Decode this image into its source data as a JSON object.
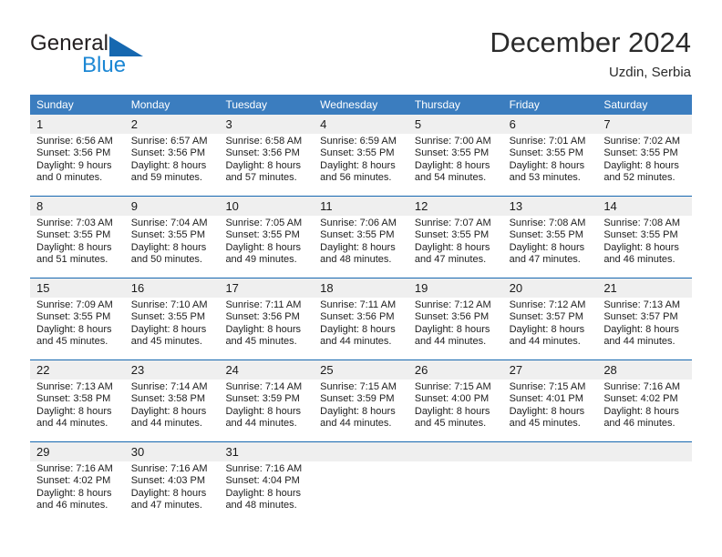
{
  "brand": {
    "name_top": "General",
    "name_bottom": "Blue"
  },
  "header": {
    "title": "December 2024",
    "location": "Uzdin, Serbia"
  },
  "weekdays": [
    "Sunday",
    "Monday",
    "Tuesday",
    "Wednesday",
    "Thursday",
    "Friday",
    "Saturday"
  ],
  "colors": {
    "header_blue": "#3b7dbf",
    "separator_blue": "#1668b0",
    "daynum_band": "#efefef",
    "logo_blue": "#1c87d4"
  },
  "weeks": [
    [
      {
        "day": "1",
        "lines": [
          "Sunrise: 6:56 AM",
          "Sunset: 3:56 PM",
          "Daylight: 9 hours",
          "and 0 minutes."
        ]
      },
      {
        "day": "2",
        "lines": [
          "Sunrise: 6:57 AM",
          "Sunset: 3:56 PM",
          "Daylight: 8 hours",
          "and 59 minutes."
        ]
      },
      {
        "day": "3",
        "lines": [
          "Sunrise: 6:58 AM",
          "Sunset: 3:56 PM",
          "Daylight: 8 hours",
          "and 57 minutes."
        ]
      },
      {
        "day": "4",
        "lines": [
          "Sunrise: 6:59 AM",
          "Sunset: 3:55 PM",
          "Daylight: 8 hours",
          "and 56 minutes."
        ]
      },
      {
        "day": "5",
        "lines": [
          "Sunrise: 7:00 AM",
          "Sunset: 3:55 PM",
          "Daylight: 8 hours",
          "and 54 minutes."
        ]
      },
      {
        "day": "6",
        "lines": [
          "Sunrise: 7:01 AM",
          "Sunset: 3:55 PM",
          "Daylight: 8 hours",
          "and 53 minutes."
        ]
      },
      {
        "day": "7",
        "lines": [
          "Sunrise: 7:02 AM",
          "Sunset: 3:55 PM",
          "Daylight: 8 hours",
          "and 52 minutes."
        ]
      }
    ],
    [
      {
        "day": "8",
        "lines": [
          "Sunrise: 7:03 AM",
          "Sunset: 3:55 PM",
          "Daylight: 8 hours",
          "and 51 minutes."
        ]
      },
      {
        "day": "9",
        "lines": [
          "Sunrise: 7:04 AM",
          "Sunset: 3:55 PM",
          "Daylight: 8 hours",
          "and 50 minutes."
        ]
      },
      {
        "day": "10",
        "lines": [
          "Sunrise: 7:05 AM",
          "Sunset: 3:55 PM",
          "Daylight: 8 hours",
          "and 49 minutes."
        ]
      },
      {
        "day": "11",
        "lines": [
          "Sunrise: 7:06 AM",
          "Sunset: 3:55 PM",
          "Daylight: 8 hours",
          "and 48 minutes."
        ]
      },
      {
        "day": "12",
        "lines": [
          "Sunrise: 7:07 AM",
          "Sunset: 3:55 PM",
          "Daylight: 8 hours",
          "and 47 minutes."
        ]
      },
      {
        "day": "13",
        "lines": [
          "Sunrise: 7:08 AM",
          "Sunset: 3:55 PM",
          "Daylight: 8 hours",
          "and 47 minutes."
        ]
      },
      {
        "day": "14",
        "lines": [
          "Sunrise: 7:08 AM",
          "Sunset: 3:55 PM",
          "Daylight: 8 hours",
          "and 46 minutes."
        ]
      }
    ],
    [
      {
        "day": "15",
        "lines": [
          "Sunrise: 7:09 AM",
          "Sunset: 3:55 PM",
          "Daylight: 8 hours",
          "and 45 minutes."
        ]
      },
      {
        "day": "16",
        "lines": [
          "Sunrise: 7:10 AM",
          "Sunset: 3:55 PM",
          "Daylight: 8 hours",
          "and 45 minutes."
        ]
      },
      {
        "day": "17",
        "lines": [
          "Sunrise: 7:11 AM",
          "Sunset: 3:56 PM",
          "Daylight: 8 hours",
          "and 45 minutes."
        ]
      },
      {
        "day": "18",
        "lines": [
          "Sunrise: 7:11 AM",
          "Sunset: 3:56 PM",
          "Daylight: 8 hours",
          "and 44 minutes."
        ]
      },
      {
        "day": "19",
        "lines": [
          "Sunrise: 7:12 AM",
          "Sunset: 3:56 PM",
          "Daylight: 8 hours",
          "and 44 minutes."
        ]
      },
      {
        "day": "20",
        "lines": [
          "Sunrise: 7:12 AM",
          "Sunset: 3:57 PM",
          "Daylight: 8 hours",
          "and 44 minutes."
        ]
      },
      {
        "day": "21",
        "lines": [
          "Sunrise: 7:13 AM",
          "Sunset: 3:57 PM",
          "Daylight: 8 hours",
          "and 44 minutes."
        ]
      }
    ],
    [
      {
        "day": "22",
        "lines": [
          "Sunrise: 7:13 AM",
          "Sunset: 3:58 PM",
          "Daylight: 8 hours",
          "and 44 minutes."
        ]
      },
      {
        "day": "23",
        "lines": [
          "Sunrise: 7:14 AM",
          "Sunset: 3:58 PM",
          "Daylight: 8 hours",
          "and 44 minutes."
        ]
      },
      {
        "day": "24",
        "lines": [
          "Sunrise: 7:14 AM",
          "Sunset: 3:59 PM",
          "Daylight: 8 hours",
          "and 44 minutes."
        ]
      },
      {
        "day": "25",
        "lines": [
          "Sunrise: 7:15 AM",
          "Sunset: 3:59 PM",
          "Daylight: 8 hours",
          "and 44 minutes."
        ]
      },
      {
        "day": "26",
        "lines": [
          "Sunrise: 7:15 AM",
          "Sunset: 4:00 PM",
          "Daylight: 8 hours",
          "and 45 minutes."
        ]
      },
      {
        "day": "27",
        "lines": [
          "Sunrise: 7:15 AM",
          "Sunset: 4:01 PM",
          "Daylight: 8 hours",
          "and 45 minutes."
        ]
      },
      {
        "day": "28",
        "lines": [
          "Sunrise: 7:16 AM",
          "Sunset: 4:02 PM",
          "Daylight: 8 hours",
          "and 46 minutes."
        ]
      }
    ],
    [
      {
        "day": "29",
        "lines": [
          "Sunrise: 7:16 AM",
          "Sunset: 4:02 PM",
          "Daylight: 8 hours",
          "and 46 minutes."
        ]
      },
      {
        "day": "30",
        "lines": [
          "Sunrise: 7:16 AM",
          "Sunset: 4:03 PM",
          "Daylight: 8 hours",
          "and 47 minutes."
        ]
      },
      {
        "day": "31",
        "lines": [
          "Sunrise: 7:16 AM",
          "Sunset: 4:04 PM",
          "Daylight: 8 hours",
          "and 48 minutes."
        ]
      },
      {
        "day": "",
        "lines": []
      },
      {
        "day": "",
        "lines": []
      },
      {
        "day": "",
        "lines": []
      },
      {
        "day": "",
        "lines": []
      }
    ]
  ]
}
